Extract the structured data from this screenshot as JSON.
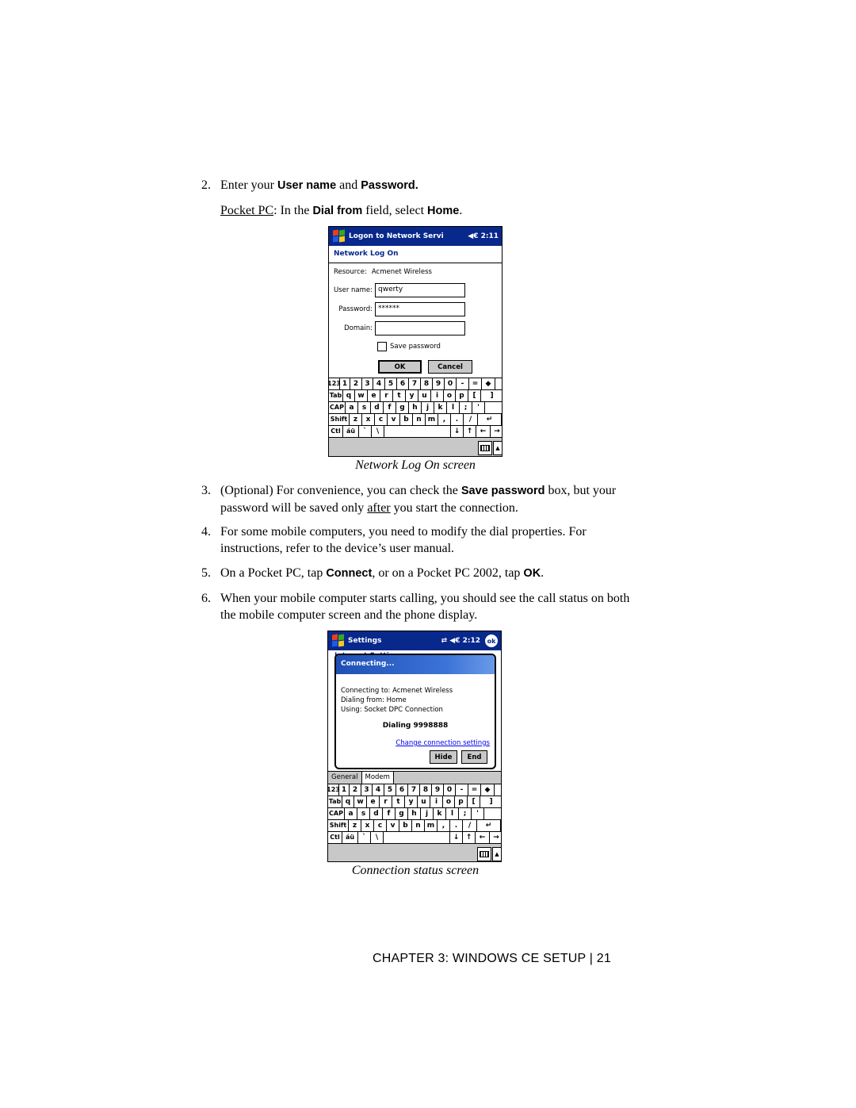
{
  "steps": {
    "s2": {
      "num": "2.",
      "pre": "Enter your ",
      "b1": "User name",
      "mid": " and ",
      "b2": "Password.",
      "line2_u": "Pocket PC",
      "line2_a": ": In the ",
      "line2_b1": "Dial from",
      "line2_c": " field, select ",
      "line2_b2": "Home",
      "line2_d": "."
    },
    "s3": {
      "num": "3.",
      "a": "(Optional) For convenience, you can check the ",
      "b": "Save password",
      "c": " box, but your password will be saved only ",
      "u": "after",
      "d": " you start the connection."
    },
    "s4": {
      "num": "4.",
      "text": "For some mobile computers, you need to modify the dial properties. For instructions, refer to the device’s user manual."
    },
    "s5": {
      "num": "5.",
      "a": "On a Pocket PC, tap ",
      "b1": "Connect",
      "c": ", or on a Pocket PC 2002, tap ",
      "b2": "OK",
      "d": "."
    },
    "s6": {
      "num": "6.",
      "text": "When your mobile computer starts calling, you should see the call status on both the mobile computer screen and the phone display."
    }
  },
  "captions": {
    "logon": "Network Log On screen",
    "connection": "Connection status screen"
  },
  "footer": "CHAPTER 3: WINDOWS CE SETUP | 21",
  "logon_screen": {
    "title": "Logon to Network Servi",
    "status": "◀€ 2:11",
    "subhead": "Network Log On",
    "resource_label": "Resource:",
    "resource_value": "Acmenet Wireless",
    "username_label": "User name:",
    "username_value": "qwerty",
    "password_label": "Password:",
    "password_value": "******",
    "domain_label": "Domain:",
    "domain_value": "",
    "save_password_label": "Save password",
    "ok_label": "OK",
    "cancel_label": "Cancel"
  },
  "connection_screen": {
    "title": "Settings",
    "status": "⇄  ◀€ 2:12",
    "ok_label": "ok",
    "behind_heading": "Internet Settings",
    "dialog_title": "Connecting...",
    "line1": "Connecting to: Acmenet Wireless",
    "line2": "Dialing from: Home",
    "line3": "Using: Socket DPC Connection",
    "dialing": "Dialing 9998888",
    "change_link": "Change connection settings",
    "hide_label": "Hide",
    "end_label": "End",
    "tabs": [
      "General",
      "Modem"
    ]
  },
  "keyboard": {
    "rows": [
      [
        "123",
        "1",
        "2",
        "3",
        "4",
        "5",
        "6",
        "7",
        "8",
        "9",
        "0",
        "-",
        "=",
        "◆"
      ],
      [
        "Tab",
        "q",
        "w",
        "e",
        "r",
        "t",
        "y",
        "u",
        "i",
        "o",
        "p",
        "[",
        "]"
      ],
      [
        "CAP",
        "a",
        "s",
        "d",
        "f",
        "g",
        "h",
        "j",
        "k",
        "l",
        ";",
        "'"
      ],
      [
        "Shift",
        "z",
        "x",
        "c",
        "v",
        "b",
        "n",
        "m",
        ",",
        ".",
        "/",
        "↵"
      ],
      [
        "Ctl",
        "áü",
        "`",
        "\\",
        " ",
        "↓",
        "↑",
        "←",
        "→"
      ]
    ]
  }
}
